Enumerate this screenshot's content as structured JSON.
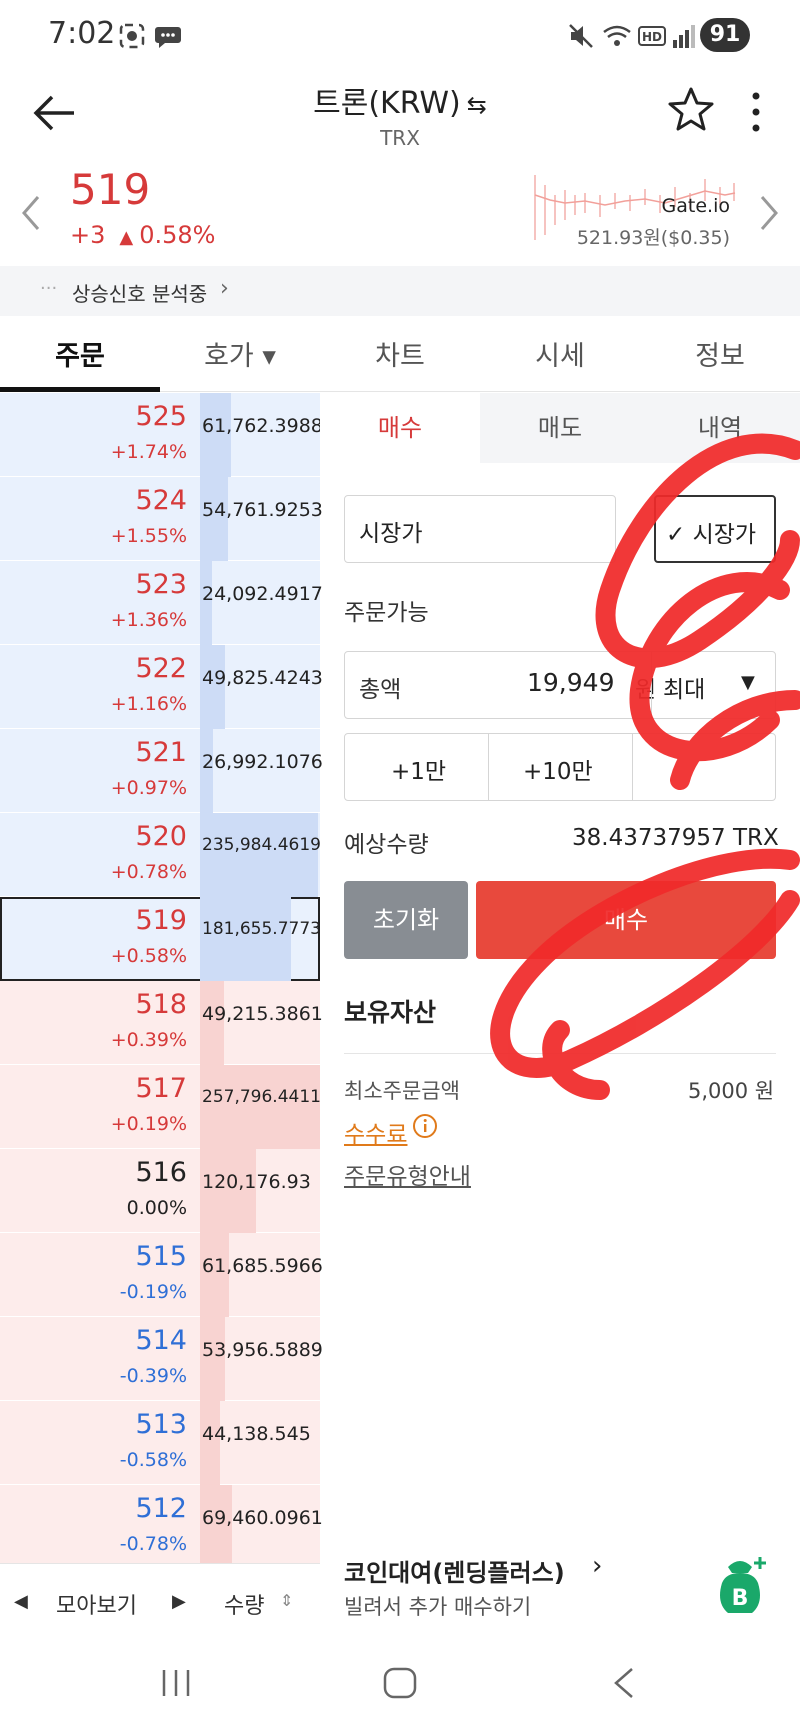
{
  "status_bar": {
    "time": "7:02",
    "battery": "91",
    "icons": [
      "screenshot-icon",
      "chat-icon",
      "mute-icon",
      "wifi-icon",
      "hd-icon",
      "signal-icon"
    ]
  },
  "header": {
    "title": "트론(KRW)",
    "swap_icon": "⇆",
    "subtitle": "TRX"
  },
  "price": {
    "current": "519",
    "change": "+3",
    "change_pct": "0.58%",
    "exchange": "Gate.io",
    "exchange_price": "521.93원($0.35)"
  },
  "signal": {
    "dots": "···",
    "text": "상승신호 분석중"
  },
  "tabs": [
    {
      "label": "주문"
    },
    {
      "label": "호가 ▾"
    },
    {
      "label": "차트"
    },
    {
      "label": "시세"
    },
    {
      "label": "정보"
    }
  ],
  "order_book": {
    "rows": [
      {
        "price": "525",
        "pct": "+1.74%",
        "qty": "61,762.3988",
        "side": "ask",
        "trend": "up",
        "fill": 0.26
      },
      {
        "price": "524",
        "pct": "+1.55%",
        "qty": "54,761.9253",
        "side": "ask",
        "trend": "up",
        "fill": 0.23
      },
      {
        "price": "523",
        "pct": "+1.36%",
        "qty": "24,092.4917",
        "side": "ask",
        "trend": "up",
        "fill": 0.1
      },
      {
        "price": "522",
        "pct": "+1.16%",
        "qty": "49,825.4243",
        "side": "ask",
        "trend": "up",
        "fill": 0.21
      },
      {
        "price": "521",
        "pct": "+0.97%",
        "qty": "26,992.1076",
        "side": "ask",
        "trend": "up",
        "fill": 0.11
      },
      {
        "price": "520",
        "pct": "+0.78%",
        "qty": "235,984.4619",
        "side": "ask",
        "trend": "up",
        "fill": 0.98
      },
      {
        "price": "519",
        "pct": "+0.58%",
        "qty": "181,655.7773",
        "side": "ask",
        "trend": "up",
        "fill": 0.76
      },
      {
        "price": "518",
        "pct": "+0.39%",
        "qty": "49,215.3861",
        "side": "bid",
        "trend": "up",
        "fill": 0.2
      },
      {
        "price": "517",
        "pct": "+0.19%",
        "qty": "257,796.4411",
        "side": "bid",
        "trend": "up",
        "fill": 1.0
      },
      {
        "price": "516",
        "pct": "0.00%",
        "qty": "120,176.93",
        "side": "bid",
        "trend": "flat",
        "fill": 0.47
      },
      {
        "price": "515",
        "pct": "-0.19%",
        "qty": "61,685.5966",
        "side": "bid",
        "trend": "down",
        "fill": 0.24
      },
      {
        "price": "514",
        "pct": "-0.39%",
        "qty": "53,956.5889",
        "side": "bid",
        "trend": "down",
        "fill": 0.21
      },
      {
        "price": "513",
        "pct": "-0.58%",
        "qty": "44,138.545",
        "side": "bid",
        "trend": "down",
        "fill": 0.17
      },
      {
        "price": "512",
        "pct": "-0.78%",
        "qty": "69,460.0961",
        "side": "bid",
        "trend": "down",
        "fill": 0.27
      }
    ],
    "footer": {
      "view_label": "모아보기",
      "qty_label": "수량"
    }
  },
  "order_panel": {
    "tabs": [
      {
        "label": "매수"
      },
      {
        "label": "매도"
      },
      {
        "label": "내역"
      }
    ],
    "order_type_value": "시장가",
    "market_toggle": "✓ 시장가",
    "available_label": "주문가능",
    "total_label": "총액",
    "total_value": "19,949",
    "total_unit": "원",
    "max_label": "최대",
    "quick_buttons": [
      "+1만",
      "+10만"
    ],
    "expected_label": "예상수량",
    "expected_value": "38.43737957 TRX",
    "reset_label": "초기화",
    "buy_label": "매수",
    "holdings_label": "보유자산",
    "min_order_label": "최소주문금액",
    "min_order_value": "5,000 원",
    "fee_label": "수수료",
    "order_type_guide": "주문유형안내",
    "lending_title": "코인대여(렌딩플러스)",
    "lending_sub": "빌려서 추가 매수하기"
  },
  "colors": {
    "up": "#d63a3a",
    "down": "#2f6fd6",
    "ask_bg": "#e9f1fd",
    "bid_bg": "#fdeceb",
    "buy_button": "#e8493d",
    "lending_green": "#1aa86a",
    "scribble": "#f02a2a"
  }
}
